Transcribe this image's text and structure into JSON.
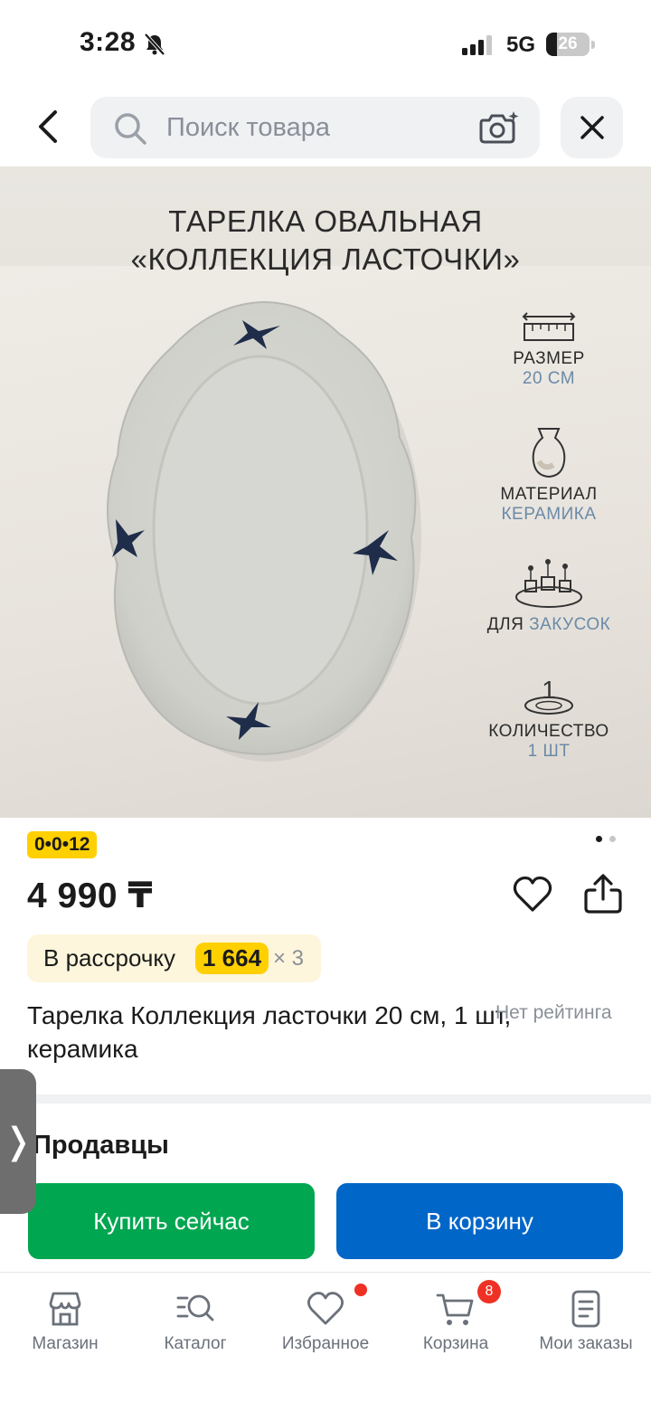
{
  "status_bar": {
    "time": "3:28",
    "network": "5G",
    "battery": "26",
    "battery_level": 0.26
  },
  "header": {
    "search_placeholder": "Поиск товара"
  },
  "product_image": {
    "title_line1": "ТАРЕЛКА ОВАЛЬНАЯ",
    "title_line2": "«КОЛЛЕКЦИЯ ЛАСТОЧКИ»",
    "specs": [
      {
        "label": "РАЗМЕР",
        "value": "20 СМ",
        "icon": "ruler-icon"
      },
      {
        "label": "МАТЕРИАЛ",
        "value": "КЕРАМИКА",
        "icon": "vase-icon"
      },
      {
        "label_prefix": "ДЛЯ",
        "value": "ЗАКУСОК",
        "icon": "appetizer-plate-icon"
      },
      {
        "label": "КОЛИЧЕСТВО",
        "value": "1 ШТ",
        "icon_number": "1",
        "icon": "single-plate-icon"
      }
    ],
    "pager_total": 2,
    "pager_active": 1
  },
  "product": {
    "code": "0•0•12",
    "price": "4 990 ₸",
    "installment_label": "В рассрочку",
    "installment_amount": "1 664",
    "installment_multiplier": "× 3",
    "title": "Тарелка Коллекция ласточки 20 см, 1 шт, керамика",
    "rating": "Нет рейтинга"
  },
  "sellers": {
    "title": "Продавцы",
    "buy_label": "Купить сейчас",
    "cart_label": "В корзину"
  },
  "side_tab": {
    "glyph": "❭"
  },
  "nav": {
    "items": [
      {
        "label": "Магазин",
        "icon": "shop-icon"
      },
      {
        "label": "Каталог",
        "icon": "catalog-search-icon"
      },
      {
        "label": "Избранное",
        "icon": "heart-icon"
      },
      {
        "label": "Корзина",
        "icon": "cart-icon",
        "badge": "8"
      },
      {
        "label": "Мои заказы",
        "icon": "orders-icon"
      }
    ]
  },
  "colors": {
    "accent_yellow": "#ffd000",
    "buy_green": "#00a650",
    "cart_blue": "#0066c8",
    "badge_red": "#ee3124"
  }
}
